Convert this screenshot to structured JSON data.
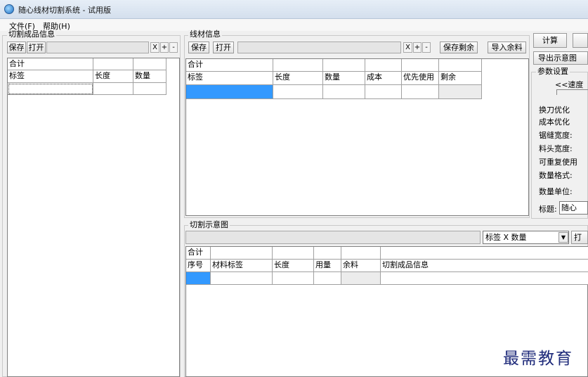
{
  "window": {
    "title": "随心线材切割系统 - 试用版"
  },
  "menu": {
    "file": "文件(F)",
    "help": "帮助(H)"
  },
  "left_panel": {
    "title": "切割成品信息",
    "save": "保存",
    "open": "打开",
    "clear_x": "X",
    "plus": "+",
    "minus": "-",
    "total_label": "合计",
    "columns": [
      "标签",
      "长度",
      "数量"
    ]
  },
  "material_panel": {
    "title": "线材信息",
    "save": "保存",
    "open": "打开",
    "clear_x": "X",
    "plus": "+",
    "minus": "-",
    "save_remainder": "保存剩余",
    "import_remainder": "导入余料",
    "total_label": "合计",
    "columns": [
      "标签",
      "长度",
      "数量",
      "成本",
      "优先使用",
      "剩余"
    ]
  },
  "right_panel": {
    "calculate": "计算",
    "export_diagram": "导出示意图",
    "params_title": "参数设置",
    "speed_label": "<<速度",
    "knife_opt": "换刀优化",
    "cost_opt": "成本优化",
    "kerf_width": "锯缝宽度:",
    "head_width": "料头宽度:",
    "reusable": "可重复使用",
    "qty_format": "数量格式:",
    "qty_unit": "数量单位:",
    "title_label": "标题:",
    "title_value": "随心"
  },
  "diagram_panel": {
    "title": "切割示意图",
    "format_select": "标签 X 数量",
    "print_partial": "打",
    "total_label": "合计",
    "columns": [
      "序号",
      "材料标签",
      "长度",
      "用量",
      "余料",
      "切割成品信息"
    ]
  },
  "watermark": "最需教育"
}
